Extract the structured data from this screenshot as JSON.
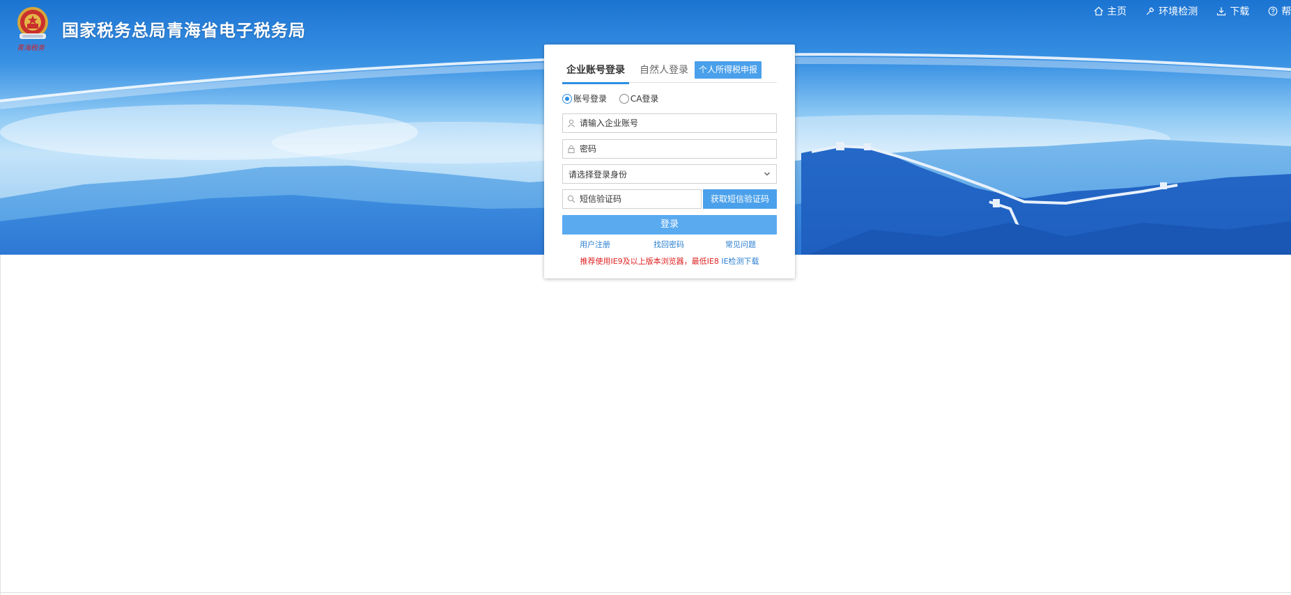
{
  "header": {
    "site_title": "国家税务总局青海省电子税务局",
    "emblem_caption": "青海税务",
    "nav": [
      {
        "label": "主页",
        "icon": "home-icon"
      },
      {
        "label": "环境检测",
        "icon": "wrench-icon"
      },
      {
        "label": "下载",
        "icon": "download-icon"
      },
      {
        "label": "帮助",
        "icon": "help-icon"
      }
    ]
  },
  "login": {
    "tabs": {
      "enterprise": "企业账号登录",
      "natural_person": "自然人登录",
      "personal_tax": "个人所得税申报"
    },
    "radios": {
      "account": "账号登录",
      "ca": "CA登录",
      "selected": "account"
    },
    "account_placeholder": "请输入企业账号",
    "password_placeholder": "密码",
    "identity_select": "请选择登录身份",
    "sms_placeholder": "短信验证码",
    "sms_button": "获取短信验证码",
    "login_button": "登录",
    "links": {
      "register": "用户注册",
      "recover": "找回密码",
      "faq": "常见问题"
    },
    "notice_text": "推荐使用IE9及以上版本浏览器，最低IE8",
    "notice_link": "IE检测下载"
  },
  "colors": {
    "accent": "#4aa0ea",
    "tab_underline": "#2d8ee2",
    "link": "#2b7fd0",
    "warning": "#e02020"
  }
}
